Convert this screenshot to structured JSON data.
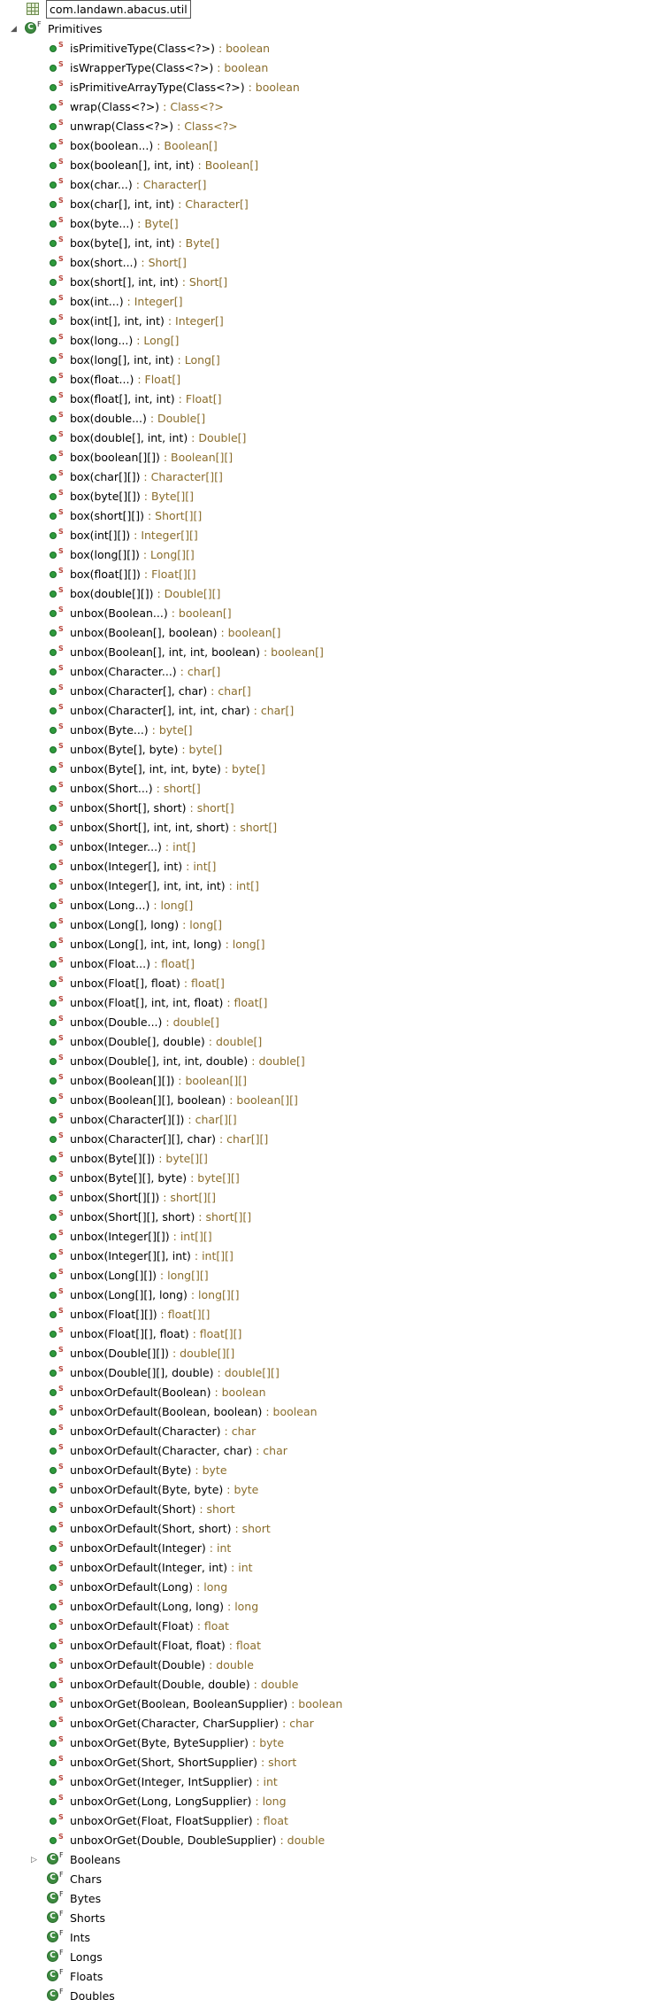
{
  "package": {
    "label": "com.landawn.abacus.util"
  },
  "root_class": {
    "name": "Primitives",
    "modifier": "F",
    "expanded": true,
    "toggle": "◢"
  },
  "static_marker": "S",
  "methods": [
    {
      "sig": "isPrimitiveType(Class<?>)",
      "ret": " : boolean"
    },
    {
      "sig": "isWrapperType(Class<?>)",
      "ret": " : boolean"
    },
    {
      "sig": "isPrimitiveArrayType(Class<?>)",
      "ret": " : boolean"
    },
    {
      "sig": "wrap(Class<?>)",
      "ret": " : Class<?>"
    },
    {
      "sig": "unwrap(Class<?>)",
      "ret": " : Class<?>"
    },
    {
      "sig": "box(boolean...)",
      "ret": " : Boolean[]"
    },
    {
      "sig": "box(boolean[], int, int)",
      "ret": " : Boolean[]"
    },
    {
      "sig": "box(char...)",
      "ret": " : Character[]"
    },
    {
      "sig": "box(char[], int, int)",
      "ret": " : Character[]"
    },
    {
      "sig": "box(byte...)",
      "ret": " : Byte[]"
    },
    {
      "sig": "box(byte[], int, int)",
      "ret": " : Byte[]"
    },
    {
      "sig": "box(short...)",
      "ret": " : Short[]"
    },
    {
      "sig": "box(short[], int, int)",
      "ret": " : Short[]"
    },
    {
      "sig": "box(int...)",
      "ret": " : Integer[]"
    },
    {
      "sig": "box(int[], int, int)",
      "ret": " : Integer[]"
    },
    {
      "sig": "box(long...)",
      "ret": " : Long[]"
    },
    {
      "sig": "box(long[], int, int)",
      "ret": " : Long[]"
    },
    {
      "sig": "box(float...)",
      "ret": " : Float[]"
    },
    {
      "sig": "box(float[], int, int)",
      "ret": " : Float[]"
    },
    {
      "sig": "box(double...)",
      "ret": " : Double[]"
    },
    {
      "sig": "box(double[], int, int)",
      "ret": " : Double[]"
    },
    {
      "sig": "box(boolean[][])",
      "ret": " : Boolean[][]"
    },
    {
      "sig": "box(char[][])",
      "ret": " : Character[][]"
    },
    {
      "sig": "box(byte[][])",
      "ret": " : Byte[][]"
    },
    {
      "sig": "box(short[][])",
      "ret": " : Short[][]"
    },
    {
      "sig": "box(int[][])",
      "ret": " : Integer[][]"
    },
    {
      "sig": "box(long[][])",
      "ret": " : Long[][]"
    },
    {
      "sig": "box(float[][])",
      "ret": " : Float[][]"
    },
    {
      "sig": "box(double[][])",
      "ret": " : Double[][]"
    },
    {
      "sig": "unbox(Boolean...)",
      "ret": " : boolean[]"
    },
    {
      "sig": "unbox(Boolean[], boolean)",
      "ret": " : boolean[]"
    },
    {
      "sig": "unbox(Boolean[], int, int, boolean)",
      "ret": " : boolean[]"
    },
    {
      "sig": "unbox(Character...)",
      "ret": " : char[]"
    },
    {
      "sig": "unbox(Character[], char)",
      "ret": " : char[]"
    },
    {
      "sig": "unbox(Character[], int, int, char)",
      "ret": " : char[]"
    },
    {
      "sig": "unbox(Byte...)",
      "ret": " : byte[]"
    },
    {
      "sig": "unbox(Byte[], byte)",
      "ret": " : byte[]"
    },
    {
      "sig": "unbox(Byte[], int, int, byte)",
      "ret": " : byte[]"
    },
    {
      "sig": "unbox(Short...)",
      "ret": " : short[]"
    },
    {
      "sig": "unbox(Short[], short)",
      "ret": " : short[]"
    },
    {
      "sig": "unbox(Short[], int, int, short)",
      "ret": " : short[]"
    },
    {
      "sig": "unbox(Integer...)",
      "ret": " : int[]"
    },
    {
      "sig": "unbox(Integer[], int)",
      "ret": " : int[]"
    },
    {
      "sig": "unbox(Integer[], int, int, int)",
      "ret": " : int[]"
    },
    {
      "sig": "unbox(Long...)",
      "ret": " : long[]"
    },
    {
      "sig": "unbox(Long[], long)",
      "ret": " : long[]"
    },
    {
      "sig": "unbox(Long[], int, int, long)",
      "ret": " : long[]"
    },
    {
      "sig": "unbox(Float...)",
      "ret": " : float[]"
    },
    {
      "sig": "unbox(Float[], float)",
      "ret": " : float[]"
    },
    {
      "sig": "unbox(Float[], int, int, float)",
      "ret": " : float[]"
    },
    {
      "sig": "unbox(Double...)",
      "ret": " : double[]"
    },
    {
      "sig": "unbox(Double[], double)",
      "ret": " : double[]"
    },
    {
      "sig": "unbox(Double[], int, int, double)",
      "ret": " : double[]"
    },
    {
      "sig": "unbox(Boolean[][])",
      "ret": " : boolean[][]"
    },
    {
      "sig": "unbox(Boolean[][], boolean)",
      "ret": " : boolean[][]"
    },
    {
      "sig": "unbox(Character[][])",
      "ret": " : char[][]"
    },
    {
      "sig": "unbox(Character[][], char)",
      "ret": " : char[][]"
    },
    {
      "sig": "unbox(Byte[][])",
      "ret": " : byte[][]"
    },
    {
      "sig": "unbox(Byte[][], byte)",
      "ret": " : byte[][]"
    },
    {
      "sig": "unbox(Short[][])",
      "ret": " : short[][]"
    },
    {
      "sig": "unbox(Short[][], short)",
      "ret": " : short[][]"
    },
    {
      "sig": "unbox(Integer[][])",
      "ret": " : int[][]"
    },
    {
      "sig": "unbox(Integer[][], int)",
      "ret": " : int[][]"
    },
    {
      "sig": "unbox(Long[][])",
      "ret": " : long[][]"
    },
    {
      "sig": "unbox(Long[][], long)",
      "ret": " : long[][]"
    },
    {
      "sig": "unbox(Float[][])",
      "ret": " : float[][]"
    },
    {
      "sig": "unbox(Float[][], float)",
      "ret": " : float[][]"
    },
    {
      "sig": "unbox(Double[][])",
      "ret": " : double[][]"
    },
    {
      "sig": "unbox(Double[][], double)",
      "ret": " : double[][]"
    },
    {
      "sig": "unboxOrDefault(Boolean)",
      "ret": " : boolean"
    },
    {
      "sig": "unboxOrDefault(Boolean, boolean)",
      "ret": " : boolean"
    },
    {
      "sig": "unboxOrDefault(Character)",
      "ret": " : char"
    },
    {
      "sig": "unboxOrDefault(Character, char)",
      "ret": " : char"
    },
    {
      "sig": "unboxOrDefault(Byte)",
      "ret": " : byte"
    },
    {
      "sig": "unboxOrDefault(Byte, byte)",
      "ret": " : byte"
    },
    {
      "sig": "unboxOrDefault(Short)",
      "ret": " : short"
    },
    {
      "sig": "unboxOrDefault(Short, short)",
      "ret": " : short"
    },
    {
      "sig": "unboxOrDefault(Integer)",
      "ret": " : int"
    },
    {
      "sig": "unboxOrDefault(Integer, int)",
      "ret": " : int"
    },
    {
      "sig": "unboxOrDefault(Long)",
      "ret": " : long"
    },
    {
      "sig": "unboxOrDefault(Long, long)",
      "ret": " : long"
    },
    {
      "sig": "unboxOrDefault(Float)",
      "ret": " : float"
    },
    {
      "sig": "unboxOrDefault(Float, float)",
      "ret": " : float"
    },
    {
      "sig": "unboxOrDefault(Double)",
      "ret": " : double"
    },
    {
      "sig": "unboxOrDefault(Double, double)",
      "ret": " : double"
    },
    {
      "sig": "unboxOrGet(Boolean, BooleanSupplier)",
      "ret": " : boolean"
    },
    {
      "sig": "unboxOrGet(Character, CharSupplier)",
      "ret": " : char"
    },
    {
      "sig": "unboxOrGet(Byte, ByteSupplier)",
      "ret": " : byte"
    },
    {
      "sig": "unboxOrGet(Short, ShortSupplier)",
      "ret": " : short"
    },
    {
      "sig": "unboxOrGet(Integer, IntSupplier)",
      "ret": " : int"
    },
    {
      "sig": "unboxOrGet(Long, LongSupplier)",
      "ret": " : long"
    },
    {
      "sig": "unboxOrGet(Float, FloatSupplier)",
      "ret": " : float"
    },
    {
      "sig": "unboxOrGet(Double, DoubleSupplier)",
      "ret": " : double"
    }
  ],
  "nested_classes": [
    {
      "name": "Booleans",
      "modifier": "F",
      "toggle": "▷"
    },
    {
      "name": "Chars",
      "modifier": "F",
      "toggle": ""
    },
    {
      "name": "Bytes",
      "modifier": "F",
      "toggle": ""
    },
    {
      "name": "Shorts",
      "modifier": "F",
      "toggle": ""
    },
    {
      "name": "Ints",
      "modifier": "F",
      "toggle": ""
    },
    {
      "name": "Longs",
      "modifier": "F",
      "toggle": ""
    },
    {
      "name": "Floats",
      "modifier": "F",
      "toggle": ""
    },
    {
      "name": "Doubles",
      "modifier": "F",
      "toggle": ""
    }
  ],
  "colors": {
    "return_type": "#8a6d2c",
    "static_marker": "#b8443a",
    "method_icon": "#2e9a3c",
    "class_icon": "#3c8a3f"
  }
}
